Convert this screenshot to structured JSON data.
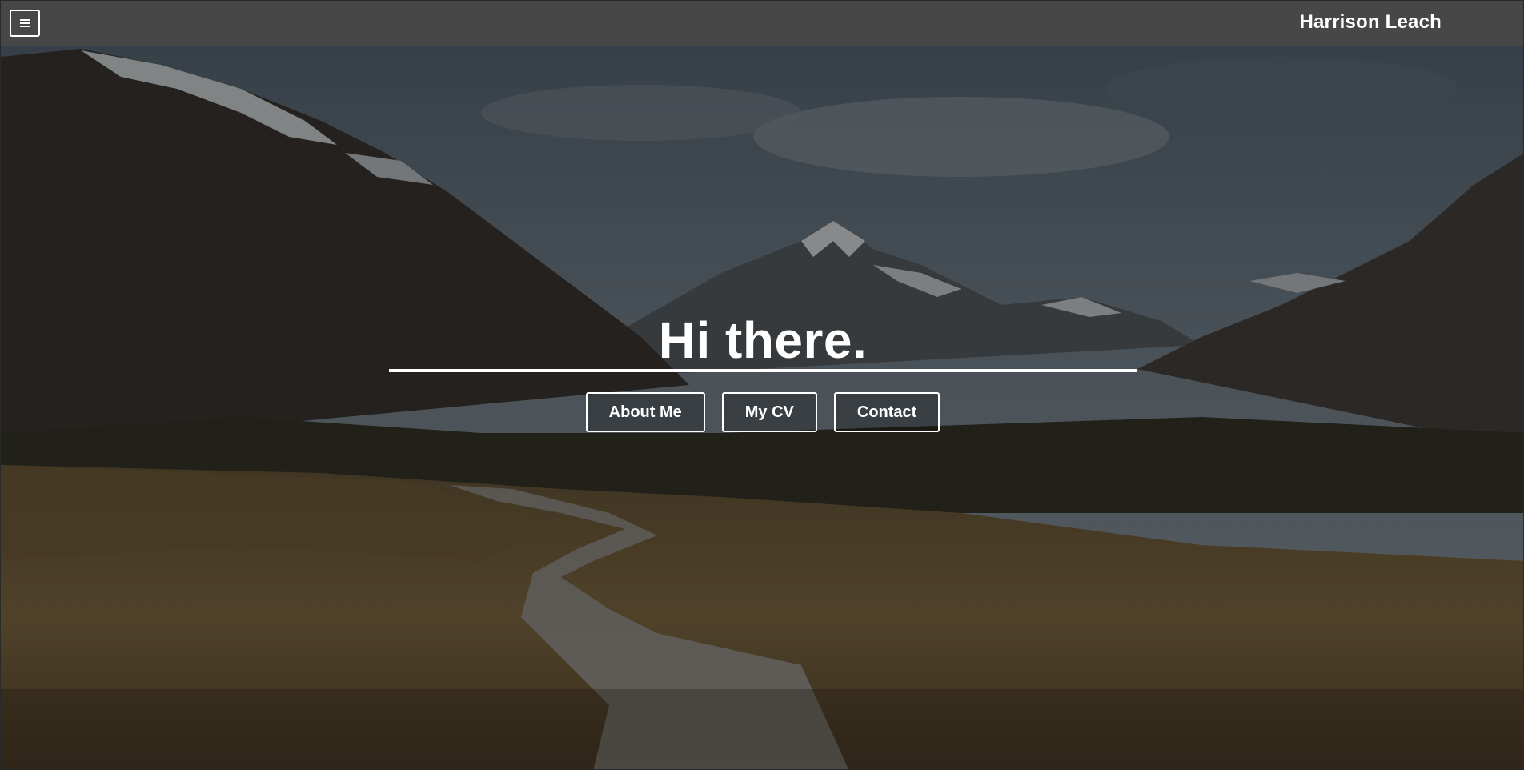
{
  "header": {
    "menu_icon": "hamburger-menu-icon",
    "site_name": "Harrison Leach"
  },
  "hero": {
    "background": "mountain-valley-boardwalk-photo",
    "title": "Hi there.",
    "buttons": [
      {
        "label": "About Me"
      },
      {
        "label": "My CV"
      },
      {
        "label": "Contact"
      }
    ]
  },
  "colors": {
    "topbar": "#474747",
    "text": "#ffffff",
    "overlay": "rgba(0,0,0,0.42)"
  }
}
